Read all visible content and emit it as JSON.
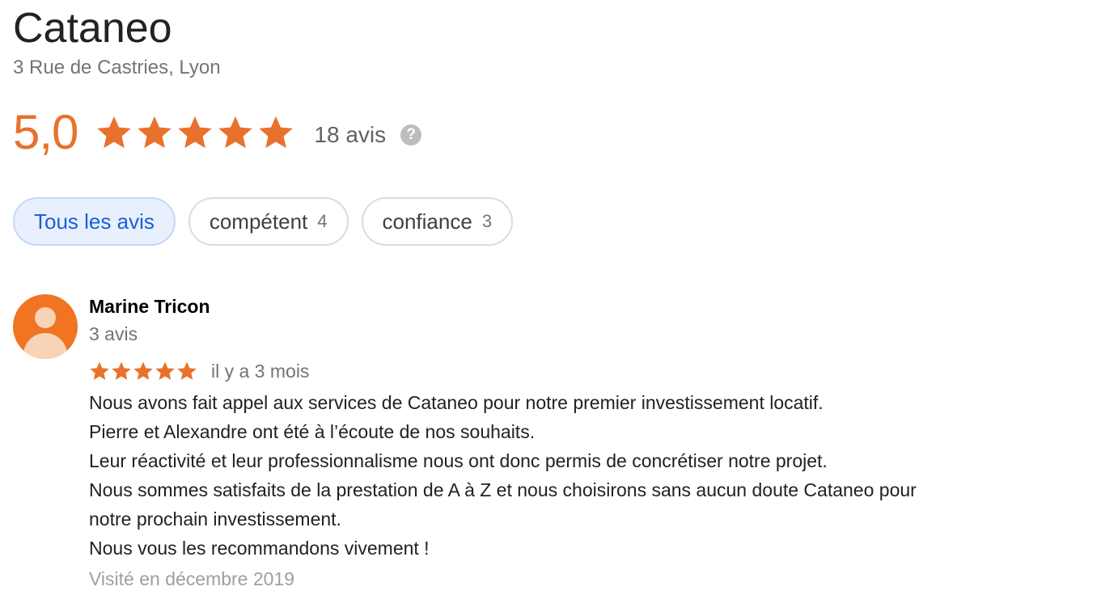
{
  "business": {
    "name": "Cataneo",
    "address": "3 Rue de Castries, Lyon"
  },
  "rating": {
    "value": "5,0",
    "stars": 5,
    "reviews_count": "18 avis",
    "help_icon": "question-icon"
  },
  "filters": [
    {
      "label": "Tous les avis",
      "count": "",
      "active": true
    },
    {
      "label": "compétent",
      "count": "4",
      "active": false
    },
    {
      "label": "confiance",
      "count": "3",
      "active": false
    }
  ],
  "review": {
    "author": "Marine Tricon",
    "author_reviews": "3 avis",
    "avatar_icon": "person-icon",
    "stars": 5,
    "date": "il y a 3 mois",
    "text_lines": [
      "Nous avons fait appel aux services de Cataneo pour notre premier investissement locatif.",
      "Pierre et Alexandre ont été à l’écoute de nos souhaits.",
      "Leur réactivité et leur professionnalisme nous ont donc permis de concrétiser notre projet.",
      "Nous sommes satisfaits de la prestation de A à Z et nous choisirons sans aucun doute Cataneo pour",
      "notre prochain investissement.",
      "Nous vous les recommandons vivement !"
    ],
    "visited": "Visité en décembre 2019"
  },
  "colors": {
    "accent": "#e8712b",
    "active_chip_bg": "#e8f0fe",
    "active_chip_text": "#1a5fd6"
  }
}
